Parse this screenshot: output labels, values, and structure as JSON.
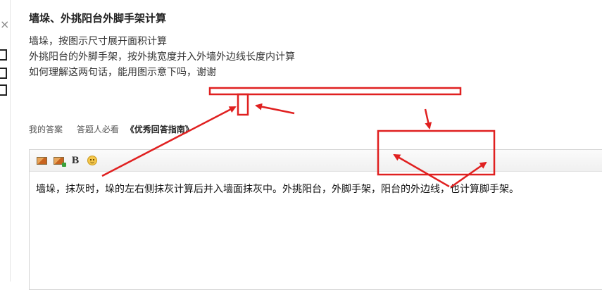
{
  "question": {
    "title": "墙垛、外挑阳台外脚手架计算",
    "lines": [
      "墙垛，按图示尺寸展开面积计算",
      "外挑阳台的外脚手架，按外挑宽度并入外墙外边线长度内计算",
      "如何理解这两句话，能用图示意下吗，谢谢"
    ]
  },
  "links": {
    "my_answer": "我的答案",
    "must_read": "答题人必看",
    "guide": "《优秀回答指南》"
  },
  "editor": {
    "toolbar": {
      "bold_label": "B"
    },
    "answer_text": "墙垛，抹灰时，垛的左右侧抹灰计算后并入墙面抹灰中。外挑阳台，外脚手架，阳台的外边线，也计算脚手架。"
  },
  "icons": {
    "close": "close-icon",
    "insert_image": "image-icon",
    "insert_multi_image": "multi-image-icon",
    "emoji": "emoji-icon"
  },
  "colors": {
    "annotation_red": "#e02020"
  }
}
